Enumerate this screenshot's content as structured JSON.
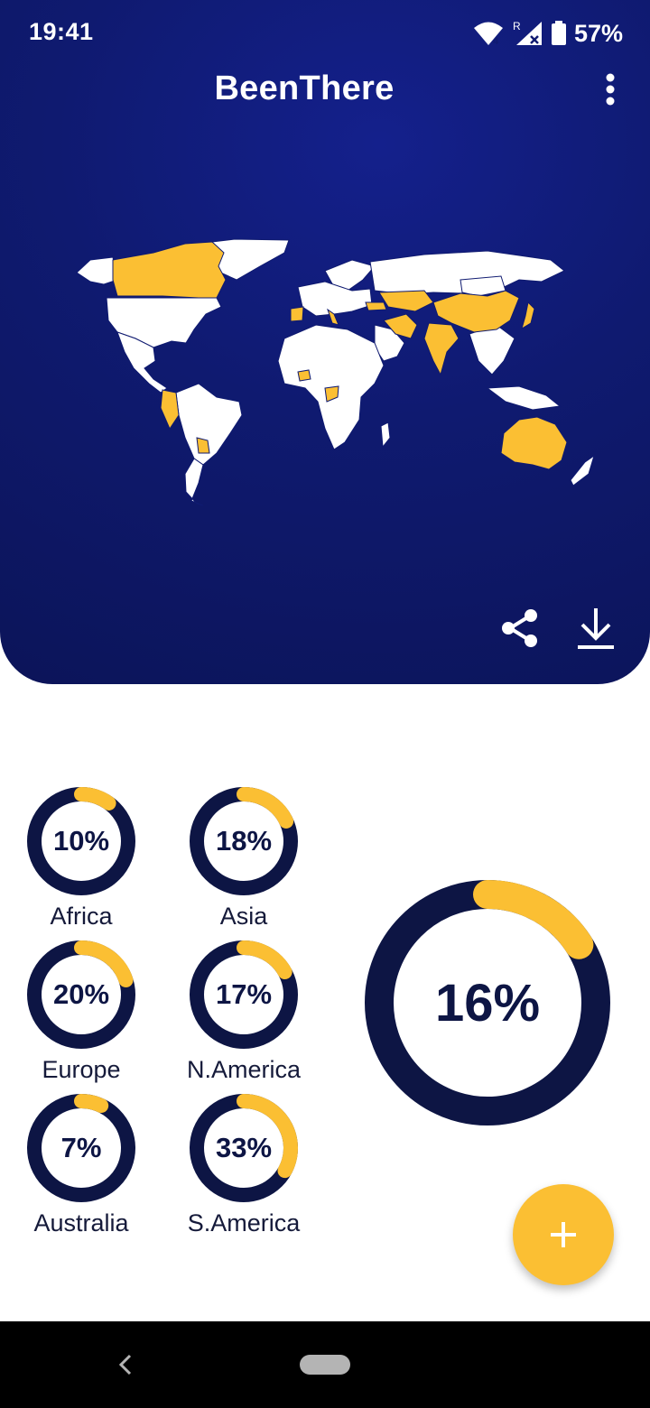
{
  "status_bar": {
    "time": "19:41",
    "battery": "57%",
    "icons": [
      "wifi-icon",
      "signal-roaming-icon",
      "battery-icon"
    ]
  },
  "app_bar": {
    "title": "BeenThere",
    "menu_icon": "more-vert-icon"
  },
  "map": {
    "visited_color": "#fbbf33",
    "unvisited_color": "#ffffff",
    "background_color": "#0f1a70"
  },
  "map_actions": {
    "share_icon": "share-icon",
    "download_icon": "download-icon"
  },
  "continents": [
    {
      "name": "Africa",
      "percent_label": "10%",
      "percent": 10
    },
    {
      "name": "Asia",
      "percent_label": "18%",
      "percent": 18
    },
    {
      "name": "Europe",
      "percent_label": "20%",
      "percent": 20
    },
    {
      "name": "N.America",
      "percent_label": "17%",
      "percent": 17
    },
    {
      "name": "Australia",
      "percent_label": "7%",
      "percent": 7
    },
    {
      "name": "S.America",
      "percent_label": "33%",
      "percent": 33
    }
  ],
  "total": {
    "percent_label": "16%",
    "percent": 16
  },
  "fab": {
    "icon": "plus-icon"
  },
  "colors": {
    "accent": "#fbbf33",
    "ring_track": "#0d1544",
    "header_bg": "#0f1a70"
  }
}
